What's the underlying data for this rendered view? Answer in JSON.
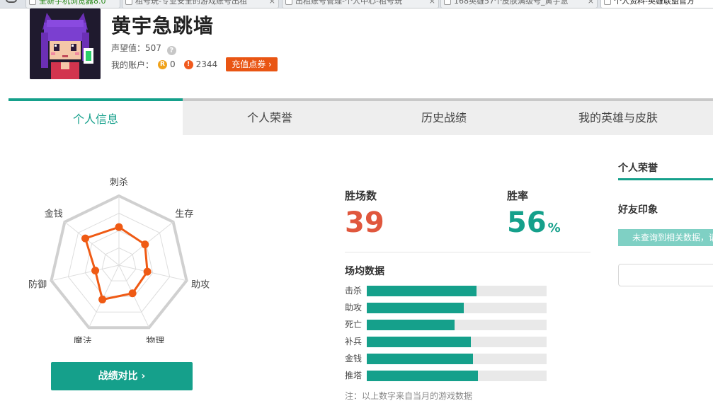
{
  "browser_tabs": [
    {
      "label": "全新手机浏览器8.0",
      "active": false
    },
    {
      "label": "租号玩-专业安全的游戏账号出租",
      "active": false
    },
    {
      "label": "出租账号管理-个人中心-租号玩",
      "active": false
    },
    {
      "label": "168英雄57个皮肤满级号_黄宇急",
      "active": false
    },
    {
      "label": "个人资料-英雄联盟官方",
      "active": true
    }
  ],
  "profile": {
    "name": "黄宇急跳墙",
    "reputation_label": "声望值：",
    "reputation_value": "507",
    "help_icon_text": "?",
    "account_label": "我的账户：",
    "r_coin_symbol": "R",
    "r_coin_value": "0",
    "d_coin_symbol": "!",
    "d_coin_value": "2344",
    "recharge_label": "充值点券 ›"
  },
  "nav": {
    "tabs": [
      "个人信息",
      "个人荣誉",
      "历史战绩",
      "我的英雄与皮肤"
    ],
    "active_index": 0
  },
  "radar": {
    "axes": [
      "刺杀",
      "生存",
      "助攻",
      "物理",
      "魔法",
      "防御",
      "金钱"
    ],
    "values": [
      0.55,
      0.48,
      0.42,
      0.45,
      0.55,
      0.35,
      0.62
    ],
    "line_color": "#ef5a14",
    "grid_color": "#d0d0d0"
  },
  "compare_button": "战绩对比 ›",
  "stats": {
    "wins_label": "胜场数",
    "wins_value": "39",
    "winrate_label": "胜率",
    "winrate_value": "56",
    "winrate_unit": "%"
  },
  "averages": {
    "title": "场均数据",
    "items": [
      {
        "label": "击杀",
        "fraction": 0.61
      },
      {
        "label": "助攻",
        "fraction": 0.54
      },
      {
        "label": "死亡",
        "fraction": 0.49
      },
      {
        "label": "补兵",
        "fraction": 0.58
      },
      {
        "label": "金钱",
        "fraction": 0.59
      },
      {
        "label": "推塔",
        "fraction": 0.62
      }
    ],
    "note": "注：以上数字来自当月的游戏数据"
  },
  "right_panel": {
    "title": "个人荣誉",
    "impression_title": "好友印象",
    "no_data_text": "未查询到相关数据，请"
  },
  "colors": {
    "accent": "#15a08b",
    "wins": "#e0573d",
    "recharge": "#e95513"
  }
}
